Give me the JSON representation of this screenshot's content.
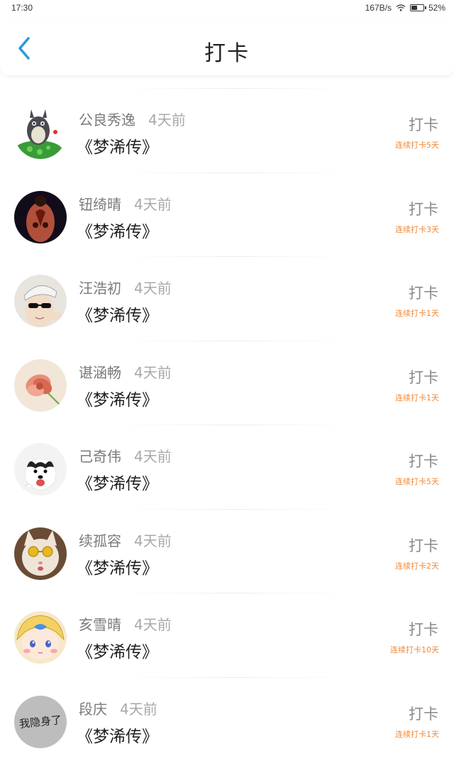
{
  "status_bar": {
    "time": "17:30",
    "speed": "167B/s",
    "battery": "52%",
    "battery_level": 0.52
  },
  "nav": {
    "title": "打卡",
    "back_icon": "chevron-left-icon",
    "accent": "#2a9bd8"
  },
  "checkins": [
    {
      "name": "公良秀逸",
      "time_ago": "4天前",
      "book": "《梦浠传》",
      "action": "打卡",
      "streak": "连续打卡5天",
      "avatar": "totoro"
    },
    {
      "name": "钮绮晴",
      "time_ago": "4天前",
      "book": "《梦浠传》",
      "action": "打卡",
      "streak": "连续打卡3天",
      "avatar": "tattoo-back"
    },
    {
      "name": "汪浩初",
      "time_ago": "4天前",
      "book": "《梦浠传》",
      "action": "打卡",
      "streak": "连续打卡1天",
      "avatar": "boy-sunglasses"
    },
    {
      "name": "谌涵畅",
      "time_ago": "4天前",
      "book": "《梦浠传》",
      "action": "打卡",
      "streak": "连续打卡1天",
      "avatar": "flower"
    },
    {
      "name": "己奇伟",
      "time_ago": "4天前",
      "book": "《梦浠传》",
      "action": "打卡",
      "streak": "连续打卡5天",
      "avatar": "husky"
    },
    {
      "name": "续孤容",
      "time_ago": "4天前",
      "book": "《梦浠传》",
      "action": "打卡",
      "streak": "连续打卡2天",
      "avatar": "cat-glasses"
    },
    {
      "name": "亥雪晴",
      "time_ago": "4天前",
      "book": "《梦浠传》",
      "action": "打卡",
      "streak": "连续打卡10天",
      "avatar": "anime-girl"
    },
    {
      "name": "段庆",
      "time_ago": "4天前",
      "book": "《梦浠传》",
      "action": "打卡",
      "streak": "连续打卡1天",
      "avatar": "text-avatar",
      "avatar_text": "我隐身了"
    }
  ],
  "colors": {
    "streak": "#ef8a3a",
    "name": "#7a7a7a",
    "time": "#a8a8a8"
  }
}
